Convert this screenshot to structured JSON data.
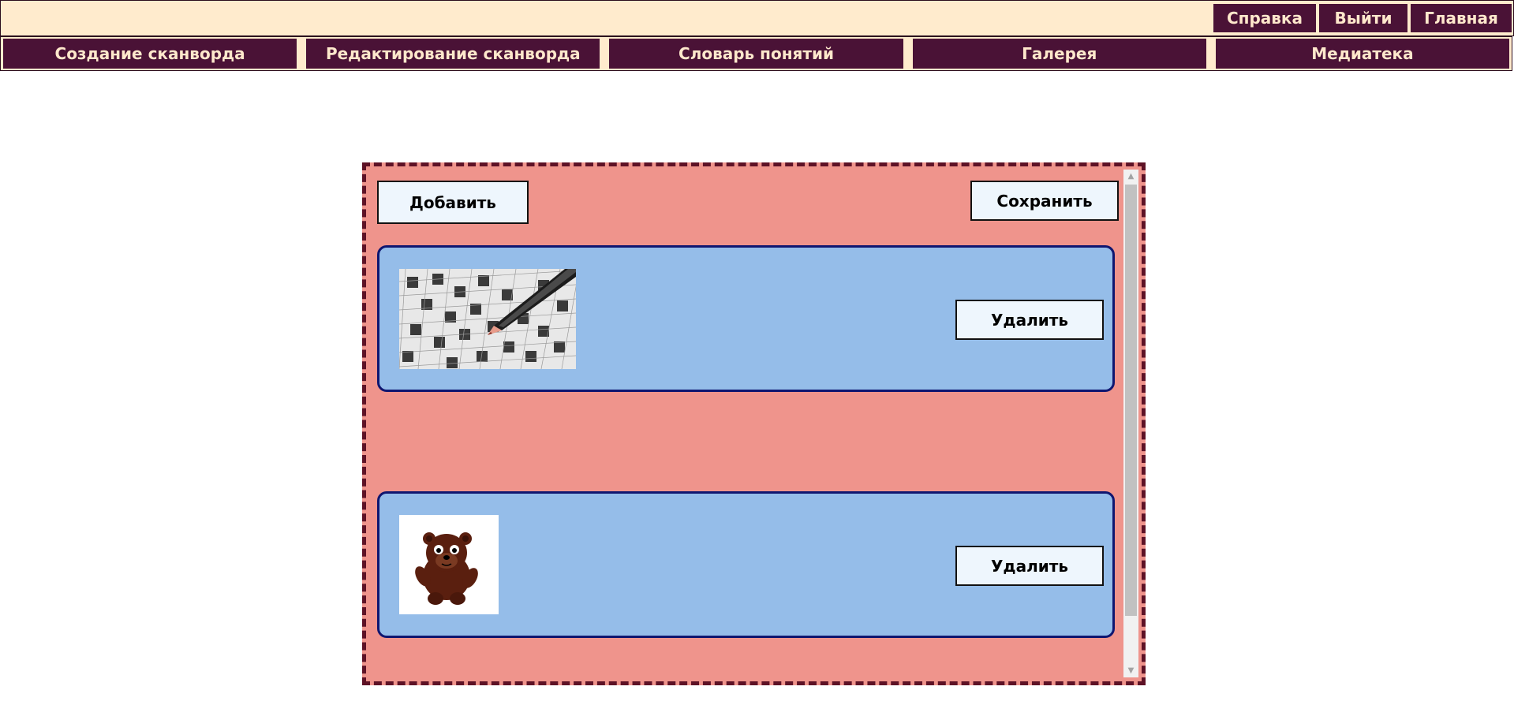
{
  "header": {
    "links": [
      {
        "label": "Справка",
        "name": "help-link"
      },
      {
        "label": "Выйти",
        "name": "logout-link"
      },
      {
        "label": "Главная",
        "name": "home-link"
      }
    ]
  },
  "nav": {
    "items": [
      {
        "label": "Создание сканворда"
      },
      {
        "label": "Редактирование сканворда"
      },
      {
        "label": "Словарь понятий"
      },
      {
        "label": "Галерея"
      },
      {
        "label": "Медиатека"
      }
    ]
  },
  "media": {
    "add_label": "Добавить",
    "save_label": "Сохранить",
    "items": [
      {
        "image": "crossword-pencil-image",
        "delete_label": "Удалить"
      },
      {
        "image": "bear-cartoon-image",
        "delete_label": "Удалить"
      }
    ]
  },
  "colors": {
    "header_bg": "#ffebcd",
    "nav_item_bg": "#4a1236",
    "nav_item_text": "#ffe8cc",
    "panel_bg": "#ef948c",
    "panel_border": "#5e1226",
    "card_bg": "#95bde9",
    "card_border": "#0f1670",
    "button_bg": "#eef6fd"
  },
  "icons": {
    "scroll_up": "▲",
    "scroll_down": "▼"
  }
}
